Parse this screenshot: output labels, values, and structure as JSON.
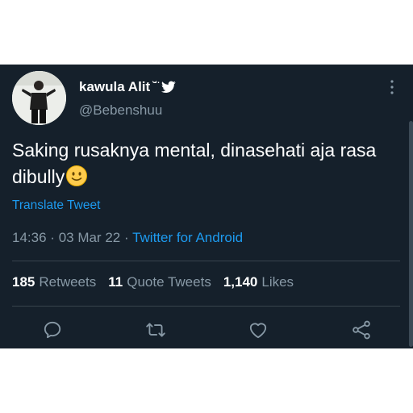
{
  "tweet": {
    "display_name": "kawula Alit",
    "name_decoration": "˘̈",
    "handle": "@Bebenshuu",
    "text": "Saking rusaknya mental, dinasehati aja rasa dibully",
    "emoji": "slightly-smiling-face",
    "translate_label": "Translate Tweet",
    "time": "14:36",
    "date": "03 Mar 22",
    "separator": "·",
    "source": "Twitter for Android"
  },
  "stats": {
    "retweets_count": "185",
    "retweets_label": "Retweets",
    "quotes_count": "11",
    "quotes_label": "Quote Tweets",
    "likes_count": "1,140",
    "likes_label": "Likes"
  },
  "icons": {
    "verified_badge": "twitter-bird-icon",
    "reply": "reply-icon",
    "retweet": "retweet-icon",
    "like": "heart-icon",
    "share": "share-icon",
    "more": "more-options-icon"
  },
  "colors": {
    "background": "#15202b",
    "text": "#ffffff",
    "secondary": "#8899a6",
    "accent": "#1d9bf0",
    "divider": "#38444d"
  }
}
